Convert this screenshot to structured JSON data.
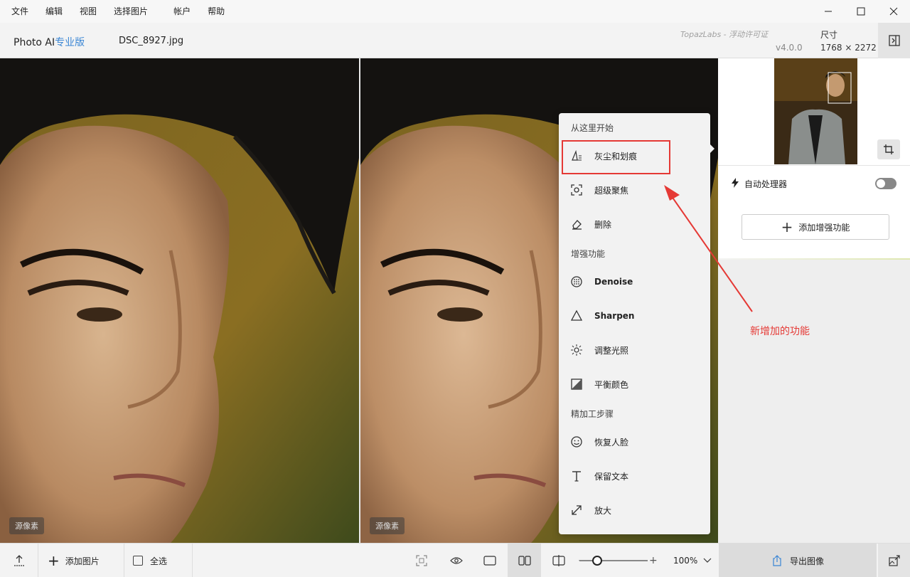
{
  "menu": {
    "items": [
      "文件",
      "编辑",
      "视图",
      "选择图片",
      "帐户",
      "帮助"
    ]
  },
  "header": {
    "brand_name": "Photo AI",
    "brand_edition": "专业版",
    "filename": "DSC_8927.jpg",
    "license": "TopazLabs - 浮动许可证",
    "version": "v4.0.0",
    "size_label": "尺寸",
    "size_value": "1768 × 2272"
  },
  "canvas": {
    "left_tag": "源像素",
    "right_tag": "源像素"
  },
  "dropdown": {
    "section_start": "从这里开始",
    "start_items": [
      {
        "label": "灰尘和划痕",
        "icon": "dust-scratch-icon"
      },
      {
        "label": "超级聚焦",
        "icon": "focus-icon"
      },
      {
        "label": "删除",
        "icon": "eraser-icon"
      }
    ],
    "section_enhance": "增强功能",
    "enhance_items": [
      {
        "label": "Denoise",
        "icon": "denoise-icon"
      },
      {
        "label": "Sharpen",
        "icon": "sharpen-icon"
      },
      {
        "label": "调整光照",
        "icon": "light-icon"
      },
      {
        "label": "平衡颜色",
        "icon": "color-balance-icon"
      }
    ],
    "section_refine": "精加工步骤",
    "refine_items": [
      {
        "label": "恢复人脸",
        "icon": "face-icon"
      },
      {
        "label": "保留文本",
        "icon": "text-icon"
      },
      {
        "label": "放大",
        "icon": "upscale-icon"
      }
    ]
  },
  "right_panel": {
    "autopilot_label": "自动处理器",
    "add_enhancement": "添加增强功能"
  },
  "annotation": "新增加的功能",
  "bottom": {
    "add_image": "添加图片",
    "select_all": "全选",
    "zoom": "100%",
    "export": "导出图像"
  },
  "colors": {
    "accent_blue": "#3a86d4",
    "annotation_red": "#e53935"
  }
}
